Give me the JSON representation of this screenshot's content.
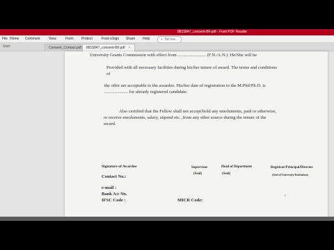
{
  "window": {
    "title": "8815847_consent-BF.pdf - Foxit PDF Reader"
  },
  "menu": {
    "items": [
      {
        "label": "File"
      },
      {
        "label": "Home"
      },
      {
        "label": "Comment"
      },
      {
        "label": "View"
      },
      {
        "label": "Form"
      },
      {
        "label": "Protect"
      },
      {
        "label": "Foxit eSign"
      },
      {
        "label": "Share"
      },
      {
        "label": "Help"
      }
    ],
    "tell_me": "Tell me..."
  },
  "tabs": {
    "left_label": "Start",
    "items": [
      {
        "label": "Consent_Contact.pdf"
      },
      {
        "label": "8815847_consent-BF.pdf"
      }
    ]
  },
  "document": {
    "line1": "University Grants Commission with effect from ......................... (F.N./A.N.). He/She will be",
    "line2": "Provided with all necessary facilities during his/her tenure of award. The terms and conditions",
    "line3": "of",
    "line4": "the offer are acceptable to the awardee. His/her date of registration to the M.Phil/Ph.D. is",
    "line5": "..................... for already registered candidate.",
    "line6": "Also certified that the Fellow shall not accept/hold any emoluments, paid or otherwise,",
    "line7": "or receive emoluments, salary, stipend etc. ,from any other source during the tenure of the",
    "line8": "award.",
    "signature_awardee": "Signature of Awardee",
    "supervisor": "Supervisor",
    "seal1": "(Seal)",
    "head_dept": "Head of Department",
    "seal2": "(Seal)",
    "registrar": "Registrar/Principal/Director",
    "seal_univ": "(Seal of University/Institution)",
    "contact": "Contact No.:",
    "email": "e-mail :",
    "bank": "Bank A/c No.",
    "ifsc": "IFSC Code :",
    "micr": "MICR Code:"
  }
}
